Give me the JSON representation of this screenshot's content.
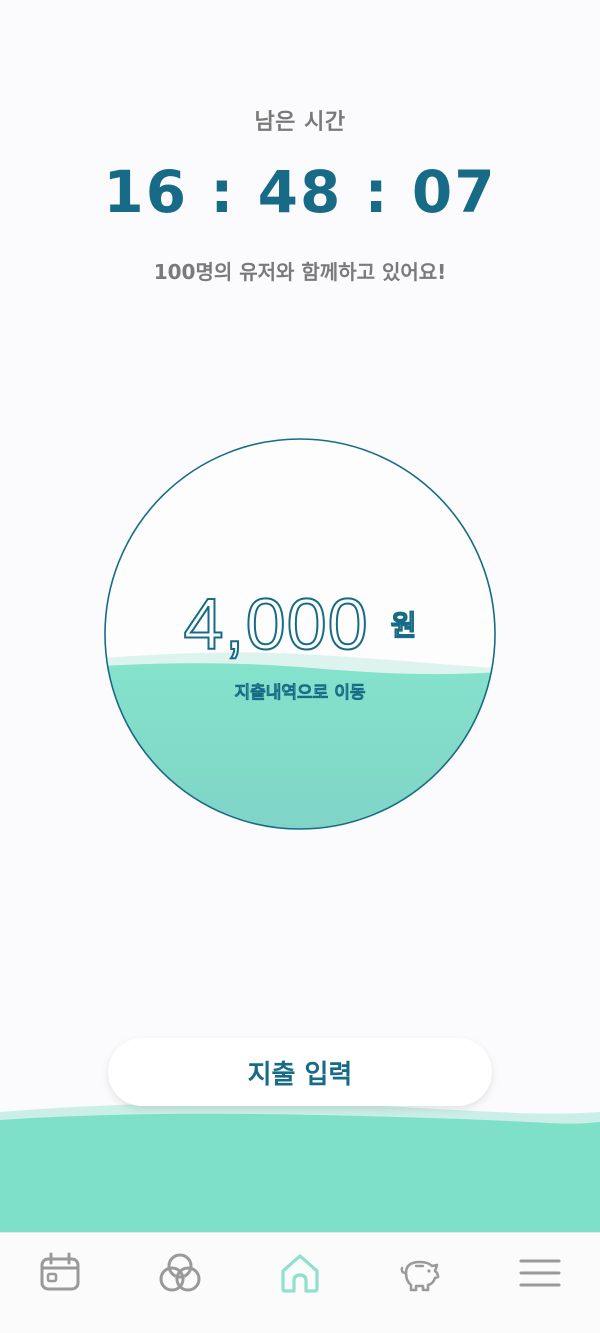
{
  "timer": {
    "label": "남은 시간",
    "value": "16 : 48 : 07",
    "users_line": "100명의 유저와 함께하고 있어요!"
  },
  "spending": {
    "amount": "4,000",
    "unit": "원",
    "link_label": "지출내역으로 이동",
    "fill_level": 0.44
  },
  "action": {
    "label": "지출 입력"
  },
  "nav": {
    "items": [
      {
        "icon": "calendar-icon",
        "active": false
      },
      {
        "icon": "venn-circles-icon",
        "active": false
      },
      {
        "icon": "home-icon",
        "active": true
      },
      {
        "icon": "piggy-bank-icon",
        "active": false
      },
      {
        "icon": "menu-icon",
        "active": false
      }
    ]
  },
  "colors": {
    "accent": "#176b86",
    "wave": "#7ee0c7",
    "inactive_icon": "#9a9a9a",
    "active_icon": "#8fe0cd"
  }
}
